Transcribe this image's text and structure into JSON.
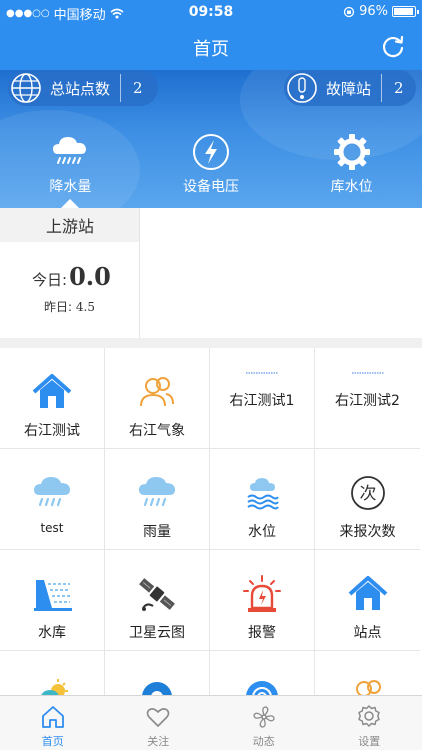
{
  "status_bar": {
    "carrier": "中国移动",
    "time": "09:58",
    "battery": "96%"
  },
  "nav": {
    "title": "首页"
  },
  "stats": {
    "total_label": "总站点数",
    "total_value": "2",
    "fault_label": "故障站",
    "fault_value": "2"
  },
  "hero_tabs": [
    {
      "label": "降水量",
      "icon": "rain-cloud-icon",
      "active": true
    },
    {
      "label": "设备电压",
      "icon": "lightning-icon",
      "active": false
    },
    {
      "label": "库水位",
      "icon": "gear-icon",
      "active": false
    }
  ],
  "station": {
    "name": "上游站",
    "today_label": "今日:",
    "today_value": "0.0",
    "yesterday_label": "昨日:",
    "yesterday_value": "4.5"
  },
  "grid": [
    {
      "label": "右江测试",
      "icon": "home-icon"
    },
    {
      "label": "右江气象",
      "icon": "users-icon"
    },
    {
      "label": "右江测试1",
      "icon": "placeholder-text"
    },
    {
      "label": "右江测试2",
      "icon": "placeholder-text"
    },
    {
      "label": "test",
      "icon": "rain-cloud-icon"
    },
    {
      "label": "雨量",
      "icon": "rain-cloud-icon"
    },
    {
      "label": "水位",
      "icon": "water-level-icon"
    },
    {
      "label": "来报次数",
      "icon": "count-icon",
      "icon_char": "次"
    },
    {
      "label": "水库",
      "icon": "dam-icon"
    },
    {
      "label": "卫星云图",
      "icon": "satellite-icon"
    },
    {
      "label": "报警",
      "icon": "alarm-icon"
    },
    {
      "label": "站点",
      "icon": "home-icon"
    },
    {
      "label": "",
      "icon": "sun-cloud-icon"
    },
    {
      "label": "",
      "icon": "circle-icon"
    },
    {
      "label": "",
      "icon": "target-icon"
    },
    {
      "label": "",
      "icon": "users-icon"
    }
  ],
  "tabbar": [
    {
      "label": "首页",
      "icon": "home-outline-icon",
      "active": true
    },
    {
      "label": "关注",
      "icon": "heart-icon",
      "active": false
    },
    {
      "label": "动态",
      "icon": "fan-icon",
      "active": false
    },
    {
      "label": "设置",
      "icon": "settings-icon",
      "active": false
    }
  ],
  "colors": {
    "primary": "#2d8ef0",
    "hero_dark": "#1f6fd0",
    "icon_blue": "#2d8ef0",
    "alarm_red": "#e84a3a",
    "orange": "#f0a23a"
  }
}
